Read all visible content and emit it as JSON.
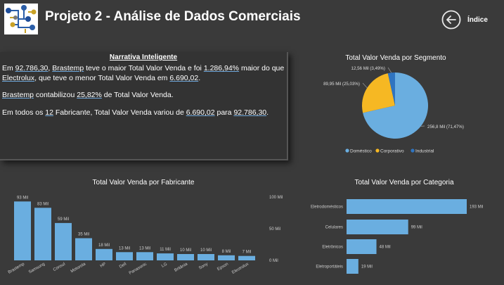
{
  "header": {
    "title": "Projeto 2 - Análise de Dados Comerciais",
    "home_label": "Índice"
  },
  "narrative": {
    "title": "Narrativa Inteligente",
    "p1": {
      "a": "Em ",
      "v1": "92.786,30",
      "b": ", ",
      "v2": "Brastemp",
      "c": " teve o maior Total Valor Venda e foi ",
      "v3": "1.286,94%",
      "d": " maior do que ",
      "v4": "Electrolux",
      "e": ", que teve o menor Total Valor Venda em ",
      "v5": "6.690,02",
      "f": "."
    },
    "p2": {
      "v1": "Brastemp",
      "a": " contabilizou ",
      "v2": "25,82%",
      "b": " de Total Valor Venda."
    },
    "p3": {
      "a": "Em todos os ",
      "v1": "12",
      "b": " Fabricante, Total Valor Venda variou de ",
      "v2": "6.690,02",
      "c": " para ",
      "v3": "92.786,30",
      "d": "."
    }
  },
  "colors": {
    "bar": "#6aaee0",
    "domestico": "#6aaee0",
    "corporativo": "#f6b823",
    "industrial": "#2f74c0"
  },
  "chart_data": [
    {
      "type": "pie",
      "title": "Total Valor Venda por Segmento",
      "labels": [
        "Doméstico",
        "Corporativo",
        "Industrial"
      ],
      "values": [
        256.8,
        89.95,
        12.56
      ],
      "data_labels": [
        "256,8 Mil (71,47%)",
        "89,95 Mil (25,03%)",
        "12,56 Mil (3,49%)"
      ],
      "legend": "bottom"
    },
    {
      "type": "bar",
      "title": "Total Valor Venda por Fabricante",
      "categories": [
        "Brastemp",
        "Samsung",
        "Consul",
        "Motorola",
        "HP",
        "Dell",
        "Panasonic",
        "LG",
        "Britânia",
        "Sony",
        "Epson",
        "Electrolux"
      ],
      "values": [
        93,
        83,
        59,
        35,
        18,
        13,
        13,
        11,
        10,
        10,
        8,
        7
      ],
      "data_labels": [
        "93 Mil",
        "83 Mil",
        "59 Mil",
        "35 Mil",
        "18 Mil",
        "13 Mil",
        "13 Mil",
        "11 Mil",
        "10 Mil",
        "10 Mil",
        "8 Mil",
        "7 Mil"
      ],
      "yticks": [
        "100 Mil",
        "50 Mil",
        "0 Mil"
      ],
      "ylim": [
        0,
        100
      ]
    },
    {
      "type": "bar",
      "title": "Total Valor Venda por Categoria",
      "categories": [
        "Eletrodomésticos",
        "Celulares",
        "Eletrônicos",
        "Eletroportáteis"
      ],
      "values": [
        193,
        99,
        48,
        19
      ],
      "data_labels": [
        "193 Mil",
        "99 Mil",
        "48 Mil",
        "19 Mil"
      ]
    }
  ]
}
